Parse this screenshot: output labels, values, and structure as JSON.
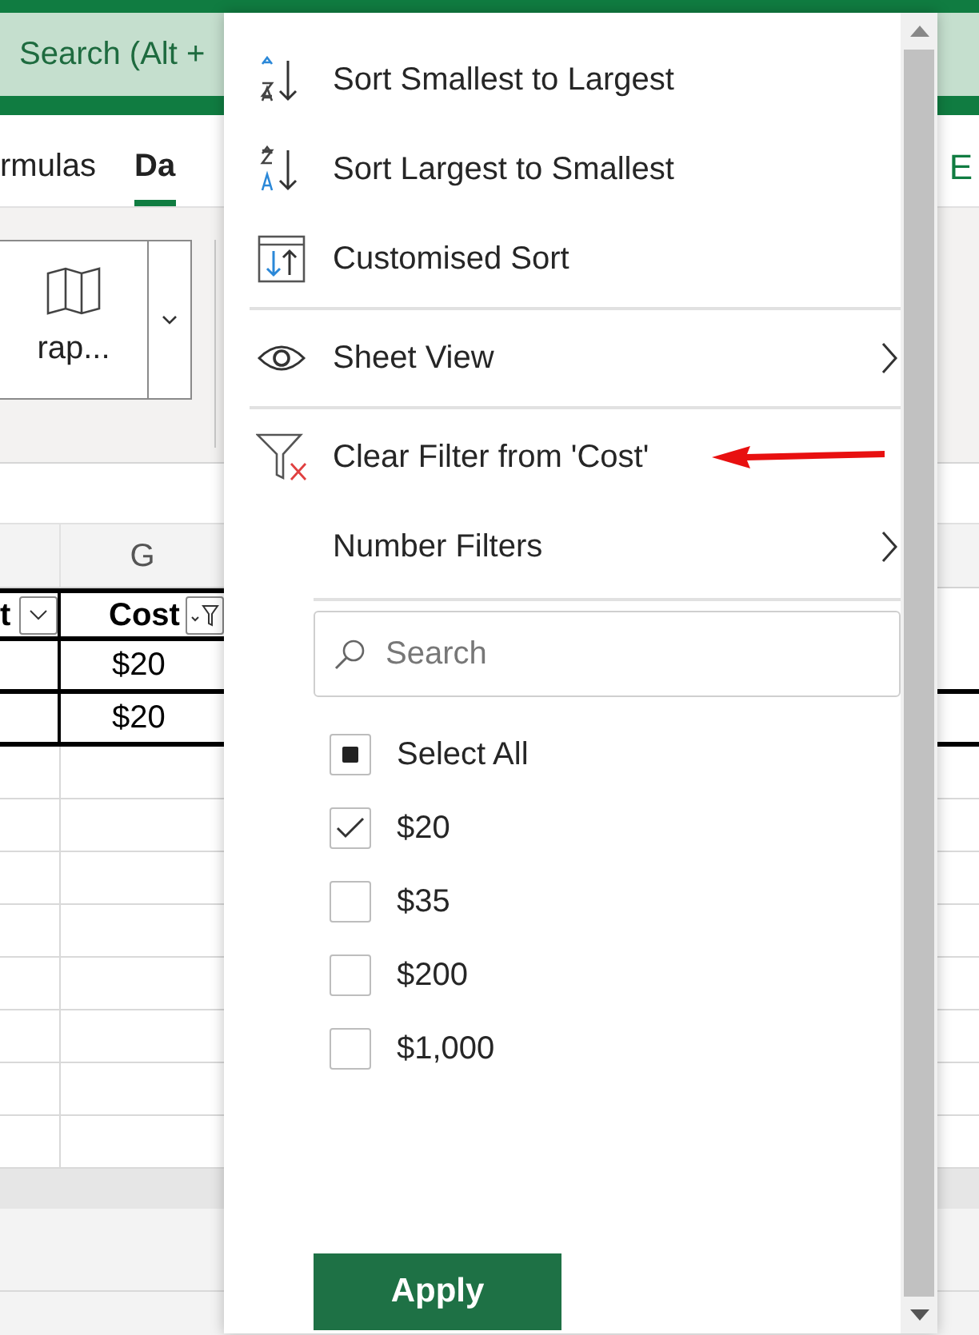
{
  "ribbon": {
    "search_placeholder": "Search (Alt +",
    "tabs": [
      {
        "label": "rmulas",
        "selected": false
      },
      {
        "label": "Da",
        "selected": true
      }
    ],
    "right_tab": "E",
    "button_label": "rap..."
  },
  "grid": {
    "column_header": "G",
    "headers": [
      {
        "label": "t",
        "filtered": false
      },
      {
        "label": "Cost",
        "filtered": true
      }
    ],
    "rows": [
      [
        "",
        "$20"
      ],
      [
        "",
        "$20"
      ]
    ]
  },
  "menu": {
    "items": [
      {
        "kind": "sort_asc",
        "label": "Sort Smallest to Largest",
        "submenu": false
      },
      {
        "kind": "sort_desc",
        "label": "Sort Largest to Smallest",
        "submenu": false
      },
      {
        "kind": "custom_sort",
        "label": "Customised Sort",
        "submenu": false
      },
      {
        "kind": "divider"
      },
      {
        "kind": "sheet_view",
        "label": "Sheet View",
        "submenu": true
      },
      {
        "kind": "divider"
      },
      {
        "kind": "clear_filter",
        "label": "Clear Filter from 'Cost'",
        "submenu": false
      },
      {
        "kind": "number_filters",
        "label": "Number Filters",
        "submenu": true
      }
    ],
    "search": {
      "placeholder": "Search"
    },
    "values": [
      {
        "label": "Select All",
        "checked": true,
        "indeterminate": true
      },
      {
        "label": "$20",
        "checked": true,
        "indeterminate": false
      },
      {
        "label": "$35",
        "checked": false,
        "indeterminate": false
      },
      {
        "label": "$200",
        "checked": false,
        "indeterminate": false
      },
      {
        "label": "$1,000",
        "checked": false,
        "indeterminate": false
      }
    ],
    "apply": "Apply"
  }
}
